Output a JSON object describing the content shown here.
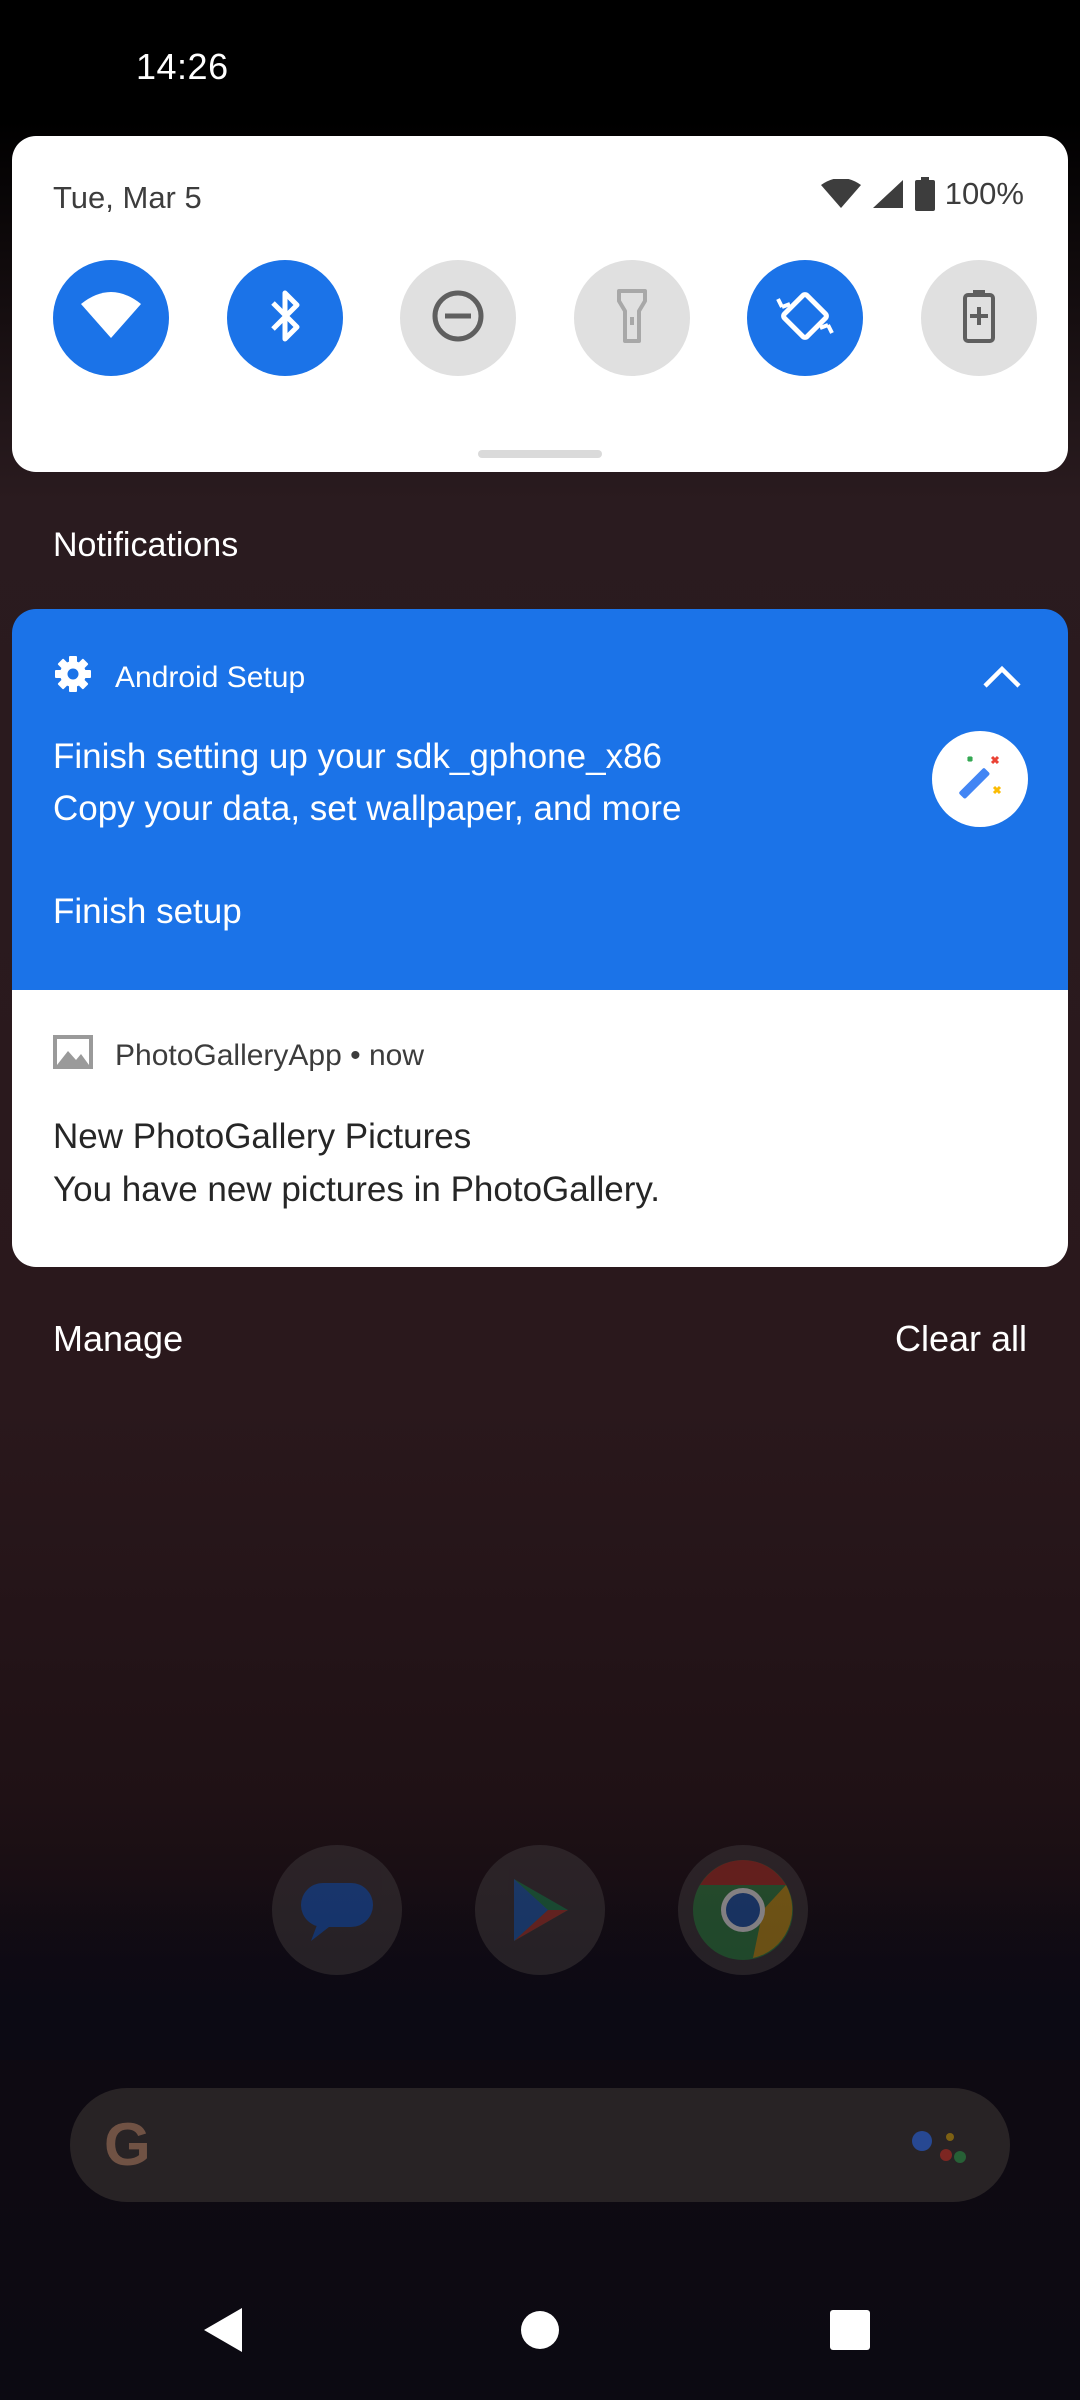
{
  "status_bar": {
    "time": "14:26"
  },
  "quick_settings": {
    "date": "Tue, Mar 5",
    "battery_text": "100%",
    "tiles": [
      {
        "name": "wifi",
        "icon": "wifi-icon",
        "state": "on"
      },
      {
        "name": "bluetooth",
        "icon": "bluetooth-icon",
        "state": "on"
      },
      {
        "name": "do-not-disturb",
        "icon": "do-not-disturb-icon",
        "state": "off"
      },
      {
        "name": "flashlight",
        "icon": "flashlight-icon",
        "state": "off"
      },
      {
        "name": "auto-rotate",
        "icon": "auto-rotate-icon",
        "state": "on"
      },
      {
        "name": "battery-saver",
        "icon": "battery-saver-icon",
        "state": "off"
      }
    ]
  },
  "notifications": {
    "header": "Notifications",
    "items": [
      {
        "app": "Android Setup",
        "app_icon": "gear-icon",
        "title": "Finish setting up your sdk_gphone_x86",
        "text": "Copy your data, set wallpaper, and more",
        "action": "Finish setup",
        "large_icon": "magic-wand-icon",
        "color": "#1b73e8"
      },
      {
        "app": "PhotoGalleryApp",
        "time": "now",
        "app_icon": "image-icon",
        "title": "New PhotoGallery Pictures",
        "text": "You have new pictures in PhotoGallery."
      }
    ],
    "manage_label": "Manage",
    "clear_all_label": "Clear all"
  },
  "home": {
    "dock_apps": [
      "messages-icon",
      "play-store-icon",
      "chrome-icon"
    ],
    "search_logo": "G"
  },
  "nav_bar": {
    "buttons": [
      "back-icon",
      "home-icon",
      "recents-icon"
    ]
  },
  "colors": {
    "accent": "#1b73e8",
    "tile_off": "#e0e0e0"
  }
}
